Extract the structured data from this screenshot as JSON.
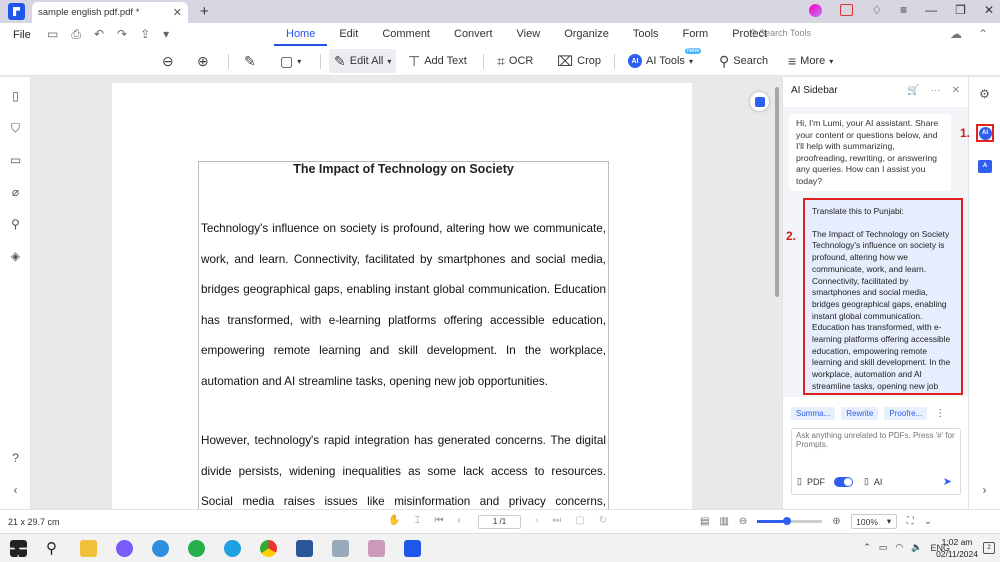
{
  "titlebar": {
    "tab_title": "sample english pdf.pdf *"
  },
  "menubar": {
    "file": "File",
    "tabs": [
      "Home",
      "Edit",
      "Comment",
      "Convert",
      "View",
      "Organize",
      "Tools",
      "Form",
      "Protect"
    ],
    "active_tab": "Home",
    "search_tools_placeholder": "Search Tools"
  },
  "toolbar": {
    "edit_all": "Edit All",
    "add_text": "Add Text",
    "ocr": "OCR",
    "crop": "Crop",
    "ai_tools": "AI Tools",
    "ai_badge": "AI",
    "new_tag": "New",
    "search": "Search",
    "more": "More"
  },
  "document": {
    "title": "The Impact of Technology on Society",
    "paragraph1": "Technology's influence on society is profound, altering how we communicate, work, and learn. Connectivity, facilitated by smartphones and social media, bridges geographical gaps, enabling instant global communication. Education has transformed, with e-learning platforms offering accessible education, empowering remote learning and skill development. In the workplace, automation and AI streamline tasks, opening new job opportunities.",
    "paragraph2": "However, technology's rapid integration has generated concerns. The digital divide persists, widening inequalities as some lack access to resources. Social media raises issues like misinformation and privacy concerns, necessitating"
  },
  "ai_sidebar": {
    "title": "AI Sidebar",
    "greeting": "Hi, I'm Lumi, your AI assistant. Share your content or questions below, and I'll help with summarizing, proofreading, rewriting, or answering any queries. How can I assist you today?",
    "user_prompt": "Translate this to Punjabi:",
    "user_text": "The Impact of Technology on Society Technology's influence on society is profound, altering how we communicate, work, and learn. Connectivity, facilitated by smartphones and social media, bridges geographical gaps, enabling instant global communication. Education has transformed, with e-learning platforms offering accessible education, empowering remote learning and skill development. In the workplace, automation and AI streamline tasks, opening new job",
    "chips": [
      "Summa...",
      "Rewrite",
      "Proofre..."
    ],
    "input_placeholder": "Ask anything unrelated to PDFs. Press '#' for Prompts.",
    "pdf_label": "PDF",
    "ai_label": "AI",
    "pdf_mode_on": true
  },
  "right_rail": {
    "ai_icon": "AI",
    "translate_icon": "A"
  },
  "annotations": {
    "one": "1.",
    "two": "2."
  },
  "statusbar": {
    "page_size": "21 x 29.7 cm",
    "page_indicator": "1 /1",
    "zoom": "100%",
    "zoom_fraction": 0.45
  },
  "taskbar": {
    "language": "ENG",
    "time": "1:02 am",
    "date": "02/11/2024",
    "notifications": "2"
  }
}
